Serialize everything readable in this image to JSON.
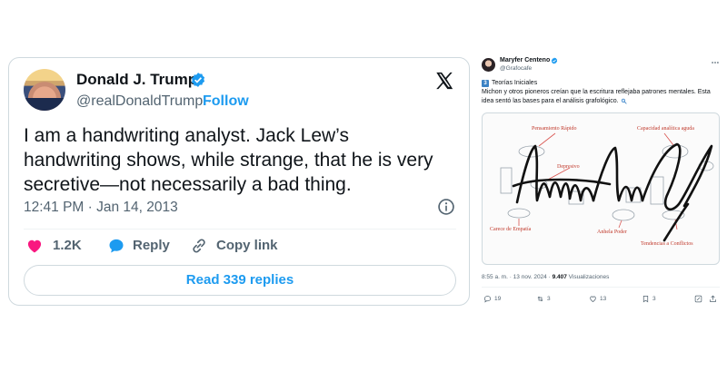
{
  "left_tweet": {
    "name": "Donald J. Trump",
    "handle": "@realDonaldTrump",
    "separator": "·",
    "follow_label": "Follow",
    "text": "I am a handwriting analyst. Jack Lew’s handwriting shows, while strange, that he is very secretive—not necessarily a bad thing.",
    "timestamp": "12:41 PM · Jan 14, 2013",
    "likes": "1.2K",
    "reply_label": "Reply",
    "copy_link_label": "Copy link",
    "read_replies_label": "Read 339 replies",
    "colors": {
      "accent": "#1d9bf0",
      "like": "#f91880",
      "verified": "#1d9bf0"
    }
  },
  "right_tweet": {
    "name": "Maryfer Centeno",
    "handle": "@Grafocafe",
    "number_badge": "3",
    "heading": "Teorías Iniciales",
    "body": "Michon y otros pioneros creían que la escritura reflejaba patrones mentales. Esta idea sentó las bases para el análisis grafológico.",
    "image_labels": {
      "pensamiento": "Pensamiento Rápido",
      "capacidad": "Capacidad analítica aguda",
      "depresivo": "Depresivo",
      "empatia": "Carece de Empatía",
      "poder": "Anhela Poder",
      "conflictos": "Tendencias a Conflictos"
    },
    "meta_time": "8:55 a. m. · 13 nov. 2024 ·",
    "views_count": "9.407",
    "views_label": "Visualizaciones",
    "replies": "19",
    "reposts": "3",
    "likes": "13",
    "bookmarks": "3"
  }
}
